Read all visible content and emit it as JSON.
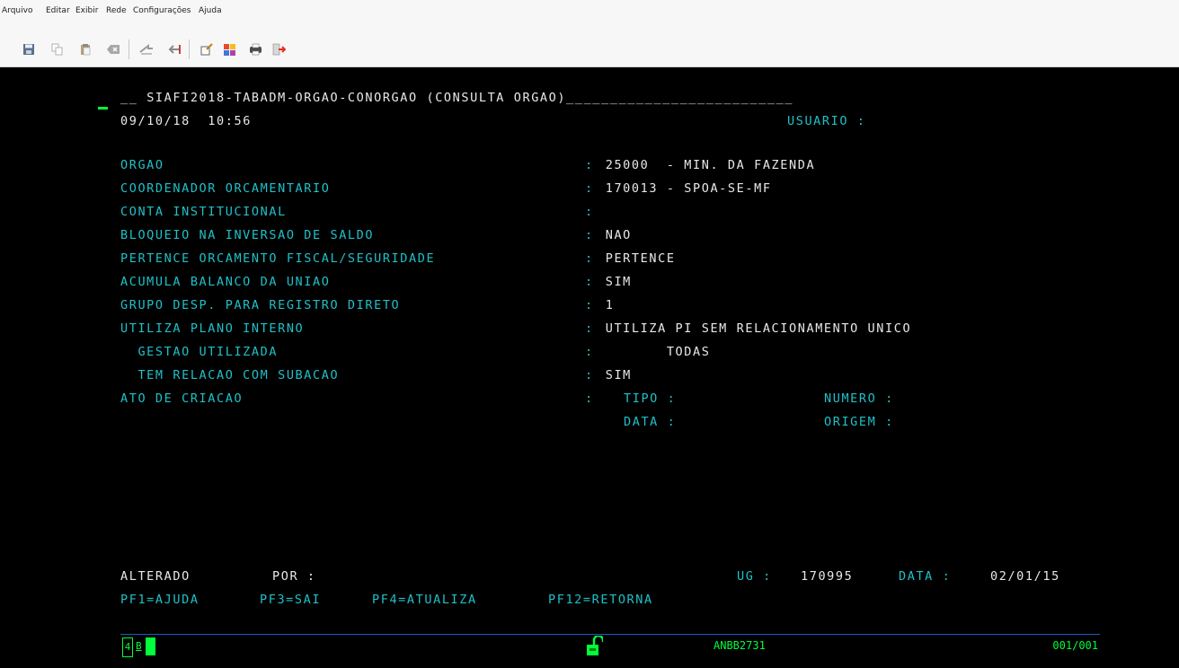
{
  "menu": [
    "Arquivo",
    "Editar",
    "Exibir",
    "Rede",
    "Configurações",
    "Ajuda"
  ],
  "toolbar": {
    "icons": [
      "save-icon",
      "copy-icon",
      "paste-icon",
      "clear-icon",
      "send-icon",
      "receive-icon",
      "macro-icon",
      "colors-icon",
      "print-icon",
      "exit-icon"
    ]
  },
  "screen": {
    "title_prefix": "__ ",
    "title": "SIAFI2018-TABADM-ORGAO-CONORGAO (CONSULTA ORGAO)",
    "title_fill": "__________________________",
    "date": "09/10/18",
    "time": "10:56",
    "usuario_label": "USUARIO :",
    "fields": [
      {
        "label": "ORGAO",
        "colon": ":",
        "value": " 25000  - MIN. DA FAZENDA"
      },
      {
        "label": "COORDENADOR ORCAMENTARIO",
        "colon": ":",
        "value": " 170013 - SPOA-SE-MF"
      },
      {
        "label": "CONTA INSTITUCIONAL",
        "colon": ":",
        "value": ""
      },
      {
        "label": "BLOQUEIO NA INVERSAO DE SALDO",
        "colon": ":",
        "value": " NAO"
      },
      {
        "label": "PERTENCE ORCAMENTO FISCAL/SEGURIDADE",
        "colon": ":",
        "value": " PERTENCE"
      },
      {
        "label": "ACUMULA BALANCO DA UNIAO",
        "colon": ":",
        "value": " SIM"
      },
      {
        "label": "GRUPO DESP. PARA REGISTRO DIRETO",
        "colon": ":",
        "value": " 1"
      },
      {
        "label": "UTILIZA PLANO INTERNO",
        "colon": ":",
        "value": " UTILIZA PI SEM RELACIONAMENTO UNICO"
      },
      {
        "label": "  GESTAO UTILIZADA",
        "colon": ":",
        "value": "        TODAS"
      },
      {
        "label": "  TEM RELACAO COM SUBACAO",
        "colon": ":",
        "value": " SIM"
      },
      {
        "label": "ATO DE CRIACAO",
        "colon": ":",
        "value": ""
      }
    ],
    "ato": {
      "tipo_label": "TIPO :",
      "numero_label": "NUMERO :",
      "data_label": "DATA :",
      "origem_label": "ORIGEM :"
    },
    "alterado_label": "ALTERADO",
    "por_label": "POR :",
    "ug_label": "UG :",
    "ug_value": "170995",
    "data_label": "DATA :",
    "data_value": "02/01/15",
    "pf_keys": [
      "PF1=AJUDA",
      "PF3=SAI",
      "PF4=ATUALIZA",
      "PF12=RETORNA"
    ]
  },
  "status": {
    "op_indicator": "4",
    "session": "B",
    "lu_name": "ANBB2731",
    "cursor_pos": "001/001"
  }
}
